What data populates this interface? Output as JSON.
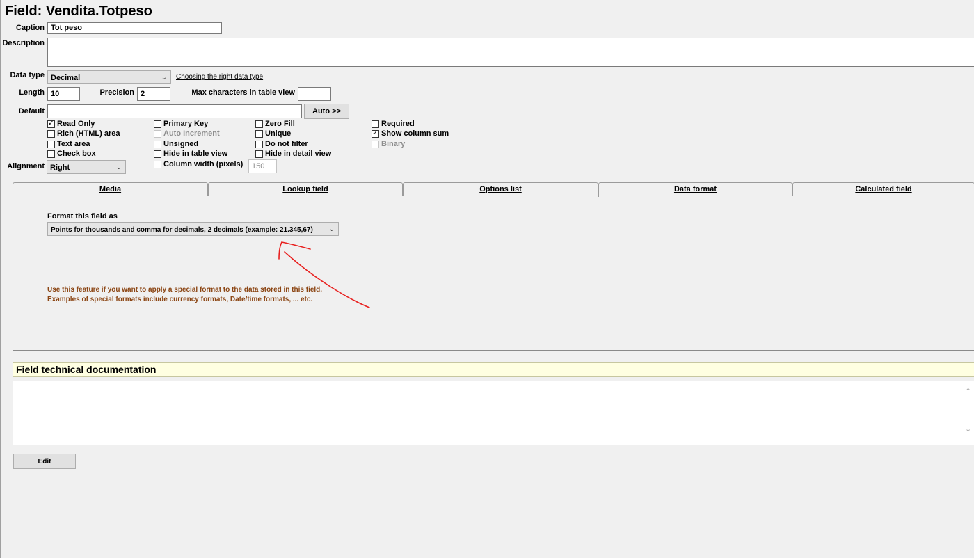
{
  "title": "Field: Vendita.Totpeso",
  "caption": {
    "label": "Caption",
    "value": "Tot peso"
  },
  "description": {
    "label": "Description",
    "value": ""
  },
  "data_type": {
    "label": "Data type",
    "value": "Decimal",
    "help_link": "Choosing the right data type"
  },
  "length": {
    "label": "Length",
    "value": "10"
  },
  "precision": {
    "label": "Precision",
    "value": "2"
  },
  "max_chars": {
    "label": "Max characters in table view",
    "value": ""
  },
  "default": {
    "label": "Default",
    "value": "",
    "auto_button": "Auto >>"
  },
  "checkboxes": {
    "read_only": {
      "label": "Read Only",
      "checked": true
    },
    "rich_html": {
      "label": "Rich (HTML) area",
      "checked": false
    },
    "text_area": {
      "label": "Text area",
      "checked": false
    },
    "check_box": {
      "label": "Check box",
      "checked": false
    },
    "primary_key": {
      "label": "Primary Key",
      "checked": false
    },
    "auto_increment": {
      "label": "Auto Increment",
      "checked": false,
      "disabled": true
    },
    "unsigned": {
      "label": "Unsigned",
      "checked": false
    },
    "hide_table_view": {
      "label": "Hide in table view",
      "checked": false
    },
    "column_width": {
      "label": "Column width (pixels)",
      "checked": false
    },
    "zero_fill": {
      "label": "Zero Fill",
      "checked": false
    },
    "unique": {
      "label": "Unique",
      "checked": false
    },
    "do_not_filter": {
      "label": "Do not filter",
      "checked": false
    },
    "hide_detail_view": {
      "label": "Hide in detail view",
      "checked": false
    },
    "required": {
      "label": "Required",
      "checked": false
    },
    "show_column_sum": {
      "label": "Show column sum",
      "checked": true
    },
    "binary": {
      "label": "Binary",
      "checked": false,
      "disabled": true
    }
  },
  "column_width_value": "150",
  "alignment": {
    "label": "Alignment",
    "value": "Right"
  },
  "tabs": [
    {
      "label": "Media"
    },
    {
      "label": "Lookup field"
    },
    {
      "label": "Options list"
    },
    {
      "label": "Data format",
      "active": true
    },
    {
      "label": "Calculated field"
    }
  ],
  "data_format": {
    "label": "Format this field as",
    "value": "Points for thousands and comma for decimals, 2 decimals (example: 21.345,67)",
    "hint_line1": "Use this feature if you want to apply a special format to the data stored in this field.",
    "hint_line2": "Examples of special formats include currency formats, Date/time formats, ... etc."
  },
  "tech_doc": {
    "title": "Field technical documentation",
    "value": ""
  },
  "edit_button": "Edit",
  "colors": {
    "hint": "#8b4513",
    "doc_header_bg": "#ffffe1",
    "annotation": "#e8201f"
  }
}
